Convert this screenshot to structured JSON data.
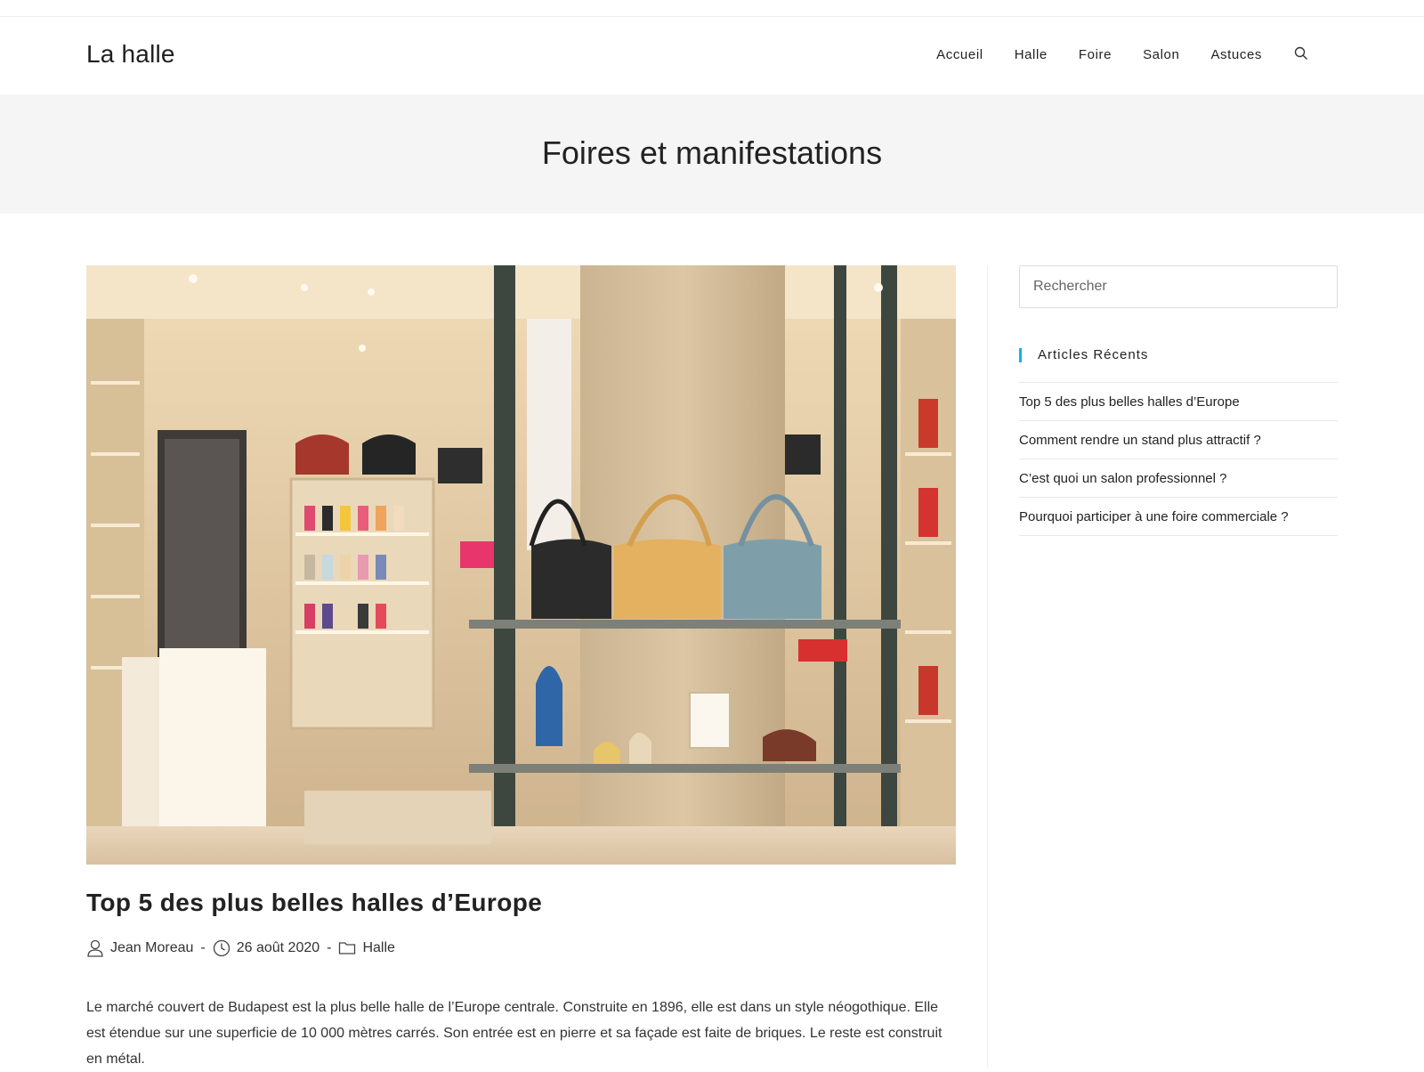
{
  "site": {
    "title": "La halle"
  },
  "nav": {
    "items": [
      {
        "label": "Accueil"
      },
      {
        "label": "Halle"
      },
      {
        "label": "Foire"
      },
      {
        "label": "Salon"
      },
      {
        "label": "Astuces"
      }
    ],
    "search_icon": "search-icon"
  },
  "page": {
    "title": "Foires et manifestations"
  },
  "post": {
    "title": "Top 5 des plus belles halles d’Europe",
    "author": "Jean Moreau",
    "date": "26 août 2020",
    "category": "Halle",
    "separator": "-",
    "excerpt": "Le marché couvert de Budapest est la plus belle halle de l’Europe centrale. Construite en 1896, elle est dans un style néogothique. Elle est étendue sur une superficie de 10 000 mètres carrés. Son entrée est en pierre et sa façade est faite de briques. Le reste est construit en métal.",
    "image_icon": "boutique-photo"
  },
  "sidebar": {
    "search_placeholder": "Rechercher",
    "recent_title": "Articles Récents",
    "recent_items": [
      {
        "label": "Top 5 des plus belles halles d’Europe"
      },
      {
        "label": "Comment rendre un stand plus attractif ?"
      },
      {
        "label": "C’est quoi un salon professionnel ?"
      },
      {
        "label": "Pourquoi participer à une foire commerciale ?"
      }
    ]
  },
  "colors": {
    "accent": "#13aff0",
    "page_header_bg": "#f5f5f5"
  }
}
